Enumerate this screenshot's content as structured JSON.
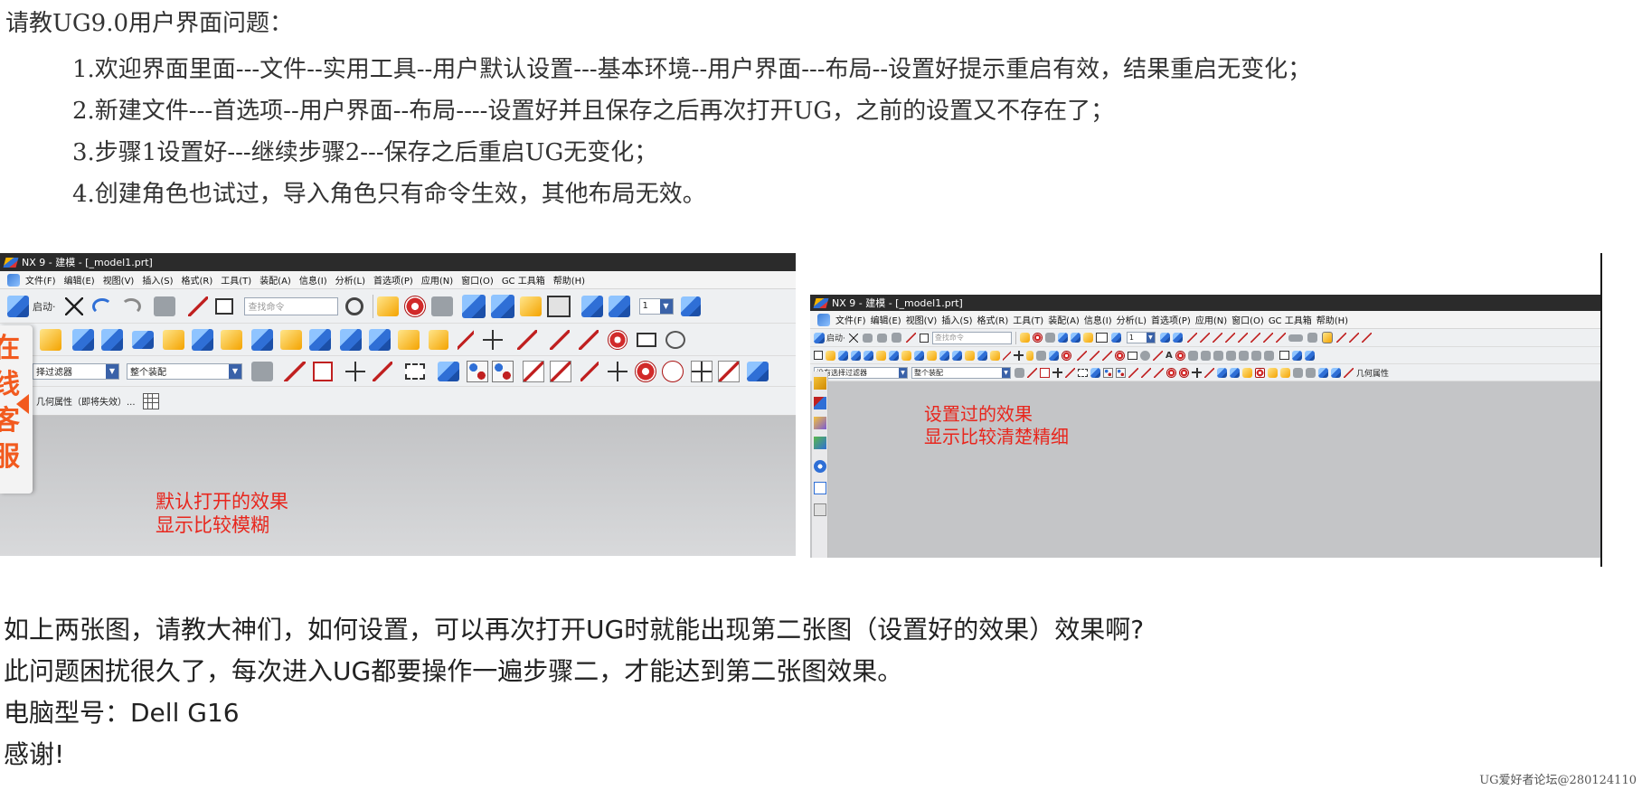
{
  "post": {
    "title": "请教UG9.0用户界面问题：",
    "steps": [
      "1.欢迎界面里面---文件--实用工具--用户默认设置---基本环境--用户界面---布局--设置好提示重启有效，结果重启无变化；",
      "2.新建文件---首选项--用户界面--布局----设置好并且保存之后再次打开UG，之前的设置又不存在了；",
      "3.步骤1设置好---继续步骤2---保存之后重启UG无变化；",
      "4.创建角色也试过，导入角色只有命令生效，其他布局无效。"
    ],
    "body": [
      " 如上两张图，请教大神们，如何设置，可以再次打开UG时就能出现第二张图（设置好的效果）效果啊?",
      "此问题困扰很久了，每次进入UG都要操作一遍步骤二，才能达到第二张图效果。",
      "电脑型号：Dell G16",
      "感谢!"
    ],
    "watermark": "UG爱好者论坛@280124110"
  },
  "screenshot1": {
    "window_title": "NX 9 - 建模 - [_model1.prt]",
    "menu": [
      "文件(F)",
      "编辑(E)",
      "视图(V)",
      "插入(S)",
      "格式(R)",
      "工具(T)",
      "装配(A)",
      "信息(I)",
      "分析(L)",
      "首选项(P)",
      "应用(N)",
      "窗口(O)",
      "GC 工具箱",
      "帮助(H)"
    ],
    "start_label": "启动·",
    "search_placeholder": "查找命令",
    "layer_value": "1",
    "filter_value": "择过滤器",
    "assembly_value": "整个装配",
    "geometry_props": "几何属性（即将失效）...",
    "caption": [
      "默认打开的效果",
      "显示比较模糊"
    ],
    "chat_tab": [
      "在",
      "线",
      "客",
      "服"
    ]
  },
  "screenshot2": {
    "window_title": "NX 9 - 建模 - [_model1.prt]",
    "menu": [
      "文件(F)",
      "编辑(E)",
      "视图(V)",
      "插入(S)",
      "格式(R)",
      "工具(T)",
      "装配(A)",
      "信息(I)",
      "分析(L)",
      "首选项(P)",
      "应用(N)",
      "窗口(O)",
      "GC 工具箱",
      "帮助(H)"
    ],
    "start_label": "启动·",
    "search_placeholder": "查找命令",
    "layer_value": "1",
    "filter_value": "没有选择过滤器",
    "assembly_value": "整个装配",
    "geometry_props": "几何属性",
    "caption": [
      "设置过的效果",
      "显示比较清楚精细"
    ]
  },
  "colors": {
    "caption_red": "#e8261d",
    "chat_orange": "#f25a1e",
    "nx_titlebar": "#2b2b2b"
  }
}
